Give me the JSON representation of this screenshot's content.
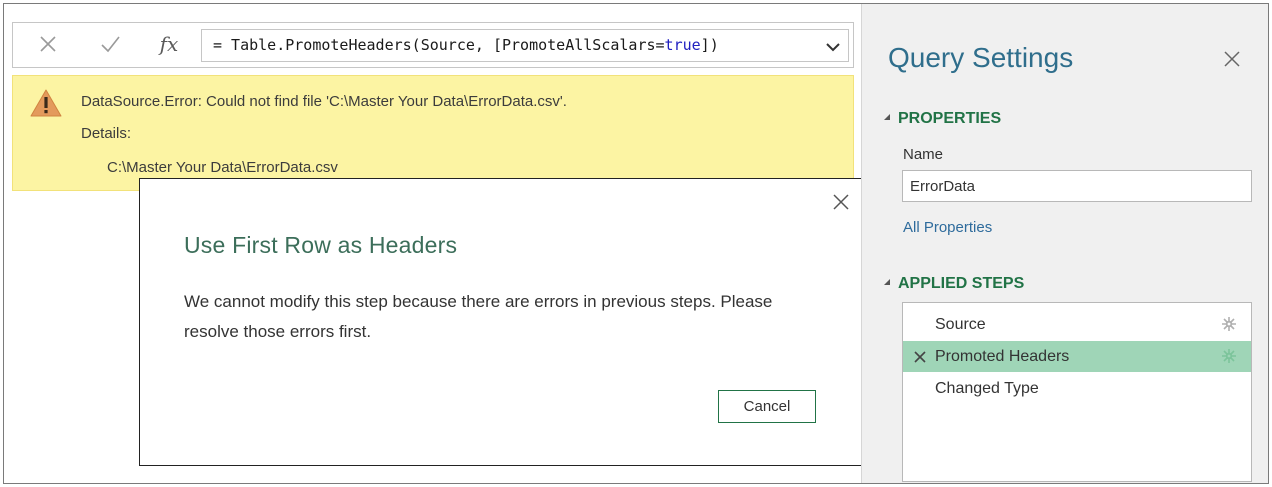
{
  "formula_bar": {
    "cancel_icon": "x-icon",
    "commit_icon": "check-icon",
    "fx_label": "fx",
    "formula_prefix": "= Table.PromoteHeaders(Source, [PromoteAllScalars=",
    "formula_keyword": "true",
    "formula_suffix": "])",
    "expand_icon": "chevron-down-icon"
  },
  "error": {
    "icon": "warning-icon",
    "line1": "DataSource.Error: Could not find file 'C:\\Master Your Data\\ErrorData.csv'.",
    "line2": "Details:",
    "line3": "C:\\Master Your Data\\ErrorData.csv",
    "colors": {
      "background": "#fcf4a3",
      "icon": "#e39a5c"
    }
  },
  "dialog": {
    "title": "Use First Row as Headers",
    "message": "We cannot modify this step because there are errors in previous steps. Please resolve those errors first.",
    "cancel_label": "Cancel",
    "close_icon": "close-icon"
  },
  "query_settings": {
    "title": "Query Settings",
    "close_icon": "close-icon",
    "properties": {
      "header": "PROPERTIES",
      "name_label": "Name",
      "name_value": "ErrorData",
      "all_properties_link": "All Properties"
    },
    "applied_steps": {
      "header": "APPLIED STEPS",
      "steps": [
        {
          "label": "Source",
          "selected": false,
          "has_error": false,
          "has_gear": true
        },
        {
          "label": "Promoted Headers",
          "selected": true,
          "has_error": true,
          "has_gear": true
        },
        {
          "label": "Changed Type",
          "selected": false,
          "has_error": false,
          "has_gear": false
        }
      ]
    },
    "colors": {
      "title": "#2f6e8c",
      "section": "#217346",
      "link": "#2e6b9c",
      "selected_step": "#9fd5b7"
    }
  }
}
